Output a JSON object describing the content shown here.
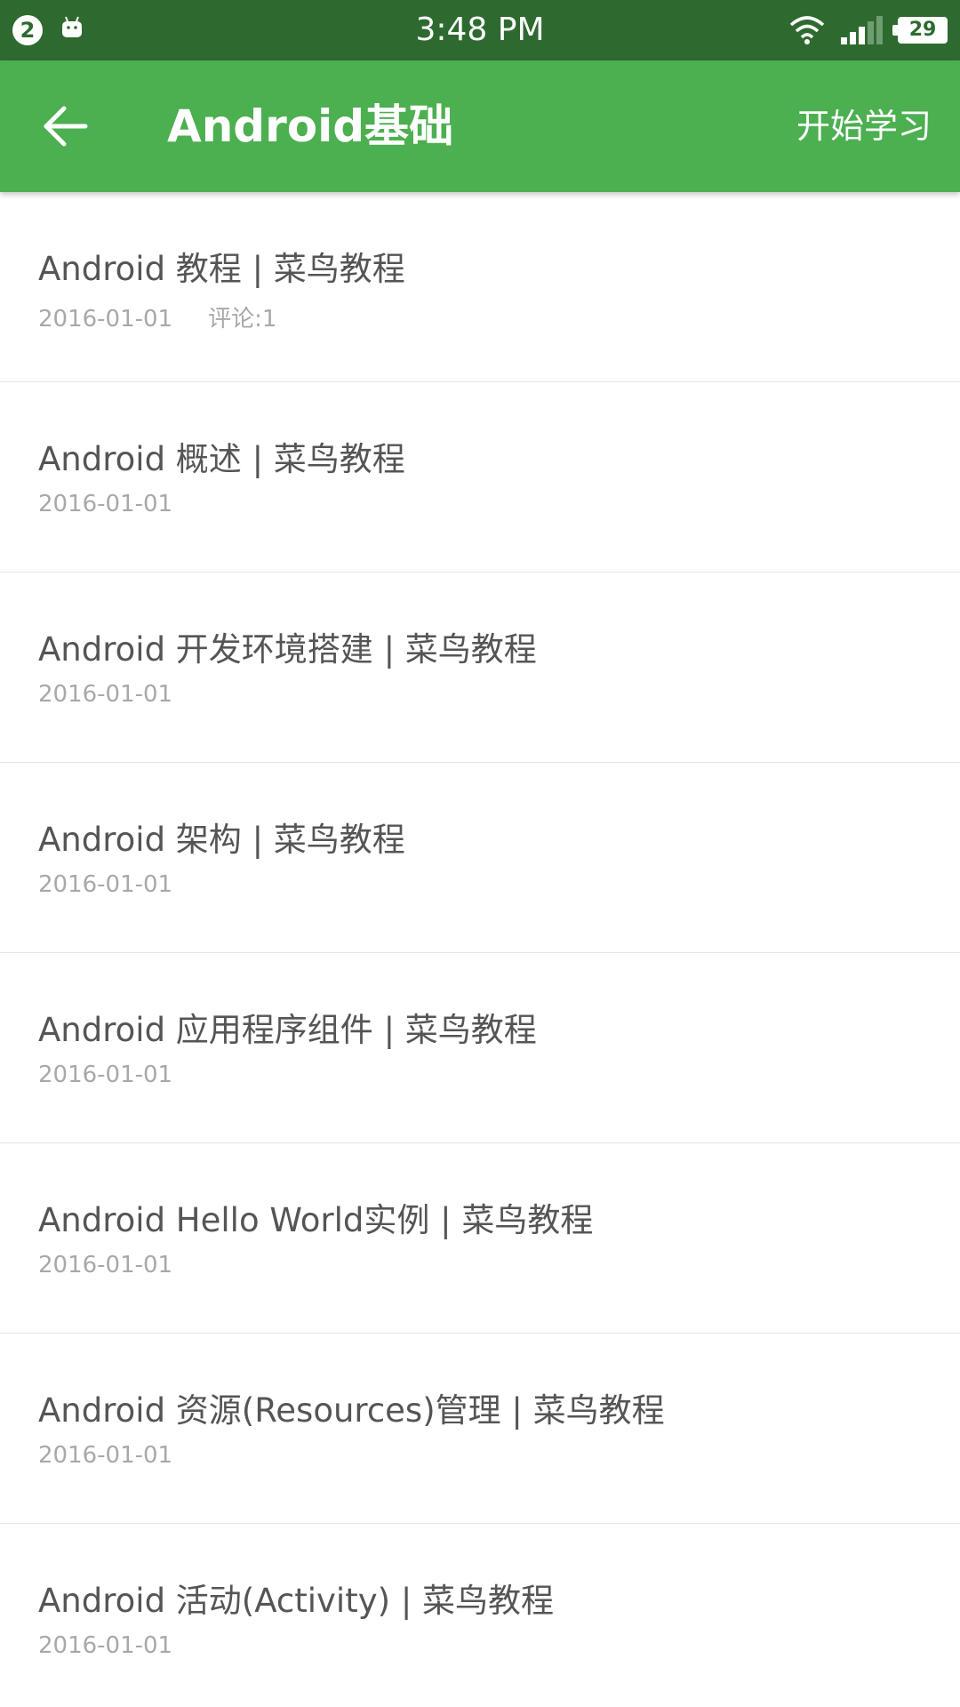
{
  "status_bar": {
    "notification_count": "2",
    "time": "3:48 PM",
    "battery": "29",
    "icons": [
      "android-icon",
      "wifi-icon",
      "signal-icon",
      "battery-icon"
    ]
  },
  "app_bar": {
    "title": "Android基础",
    "action_label": "开始学习",
    "back_icon": "arrow-left-icon",
    "color": "#4caf50"
  },
  "list": {
    "items": [
      {
        "title": "Android 教程 | 菜鸟教程",
        "date": "2016-01-01",
        "comments": "评论:1"
      },
      {
        "title": "Android 概述 | 菜鸟教程",
        "date": "2016-01-01"
      },
      {
        "title": "Android 开发环境搭建 | 菜鸟教程",
        "date": "2016-01-01"
      },
      {
        "title": "Android 架构 | 菜鸟教程",
        "date": "2016-01-01"
      },
      {
        "title": "Android 应用程序组件 | 菜鸟教程",
        "date": "2016-01-01"
      },
      {
        "title": "Android Hello World实例 | 菜鸟教程",
        "date": "2016-01-01"
      },
      {
        "title": "Android 资源(Resources)管理 | 菜鸟教程",
        "date": "2016-01-01"
      },
      {
        "title": "Android 活动(Activity) | 菜鸟教程",
        "date": "2016-01-01"
      }
    ]
  }
}
